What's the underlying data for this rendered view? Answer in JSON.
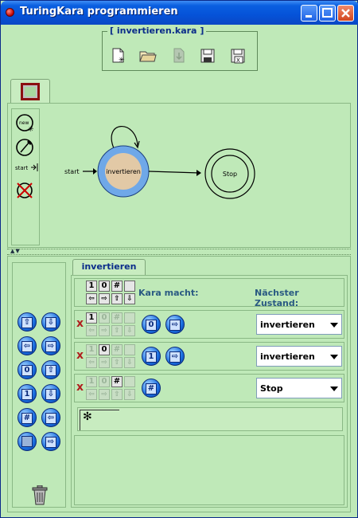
{
  "window": {
    "title": "TuringKara programmieren",
    "min": "_",
    "max": "□",
    "close": "✕"
  },
  "file_toolbar": {
    "title": "[ invertieren.kara ]",
    "icons": [
      "new-file-icon",
      "open-folder-icon",
      "import-icon",
      "save-icon",
      "save-as-icon"
    ]
  },
  "graph": {
    "tools": [
      "new-state-icon",
      "edit-state-icon",
      "start-state-icon",
      "delete-state-icon"
    ],
    "start_label": "start",
    "states": [
      {
        "name": "invertieren",
        "type": "normal"
      },
      {
        "name": "Stop",
        "type": "final"
      }
    ]
  },
  "commands": {
    "buttons": [
      "↑",
      "⇩",
      "⇦",
      "⇨",
      "0",
      "⇧",
      "1",
      "⇩",
      "#",
      "⇦",
      "",
      "⇨"
    ]
  },
  "transitions": {
    "tab": "invertieren",
    "header_cells": [
      "1",
      "0",
      "#",
      "",
      "⇦",
      "⇨",
      "⇧",
      "⇩"
    ],
    "header_kara": "Kara macht:",
    "header_next": "Nächster Zustand:",
    "rows": [
      {
        "read": "1",
        "actions": [
          "0",
          "⇨"
        ],
        "next": "invertieren"
      },
      {
        "read": "0",
        "actions": [
          "1",
          "⇨"
        ],
        "next": "invertieren"
      },
      {
        "read": "#",
        "actions": [
          "#"
        ],
        "next": "Stop"
      }
    ],
    "comment_symbol": "✻"
  },
  "colors": {
    "window_bg": "#bfe9b8",
    "titlebar": "#0552d8",
    "state_fill": "#e2c9a6",
    "state_ring": "#6fa8e8"
  }
}
